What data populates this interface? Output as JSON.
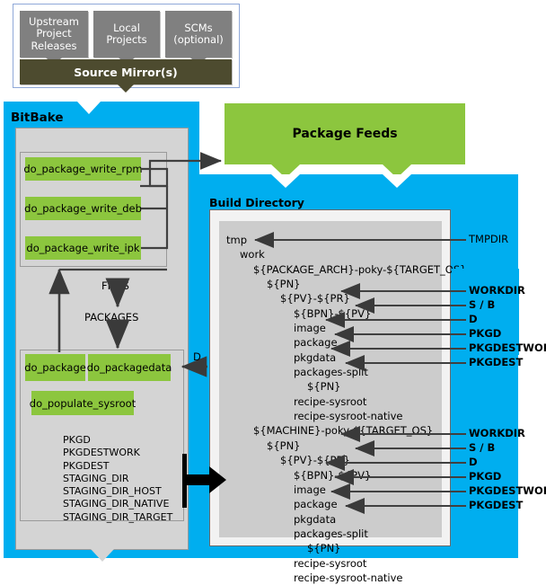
{
  "source_group": {
    "boxes": [
      {
        "label": "Upstream\nProject\nReleases",
        "name": "upstream-project-releases"
      },
      {
        "label": "Local\nProjects",
        "name": "local-projects"
      },
      {
        "label": "SCMs\n(optional)",
        "name": "scms-optional"
      }
    ],
    "mirror_label": "Source Mirror(s)"
  },
  "bitbake": {
    "title": "BitBake",
    "write_tasks": [
      "do_package_write_rpm",
      "do_package_write_deb",
      "do_package_write_ipk"
    ],
    "flow_labels": {
      "files": "FILES",
      "packages": "PACKAGES"
    },
    "package_tasks": [
      "do_package",
      "do_packagedata",
      "do_populate_sysroot"
    ],
    "variables": [
      "PKGD",
      "PKGDESTWORK",
      "PKGDEST",
      "STAGING_DIR",
      "STAGING_DIR_HOST",
      "STAGING_DIR_NATIVE",
      "STAGING_DIR_TARGET"
    ],
    "d_arrow_label": "D"
  },
  "package_feeds": {
    "title": "Package Feeds"
  },
  "build_directory": {
    "title": "Build Directory",
    "tree": [
      {
        "indent": 0,
        "text": "tmp"
      },
      {
        "indent": 1,
        "text": "work"
      },
      {
        "indent": 2,
        "text": "${PACKAGE_ARCH}-poky-${TARGET_OS}"
      },
      {
        "indent": 3,
        "text": "${PN}"
      },
      {
        "indent": 4,
        "text": "${PV}-${PR}"
      },
      {
        "indent": 5,
        "text": "${BPN}-${PV}"
      },
      {
        "indent": 5,
        "text": "image"
      },
      {
        "indent": 5,
        "text": "package"
      },
      {
        "indent": 5,
        "text": "pkgdata"
      },
      {
        "indent": 5,
        "text": "packages-split"
      },
      {
        "indent": 6,
        "text": "${PN}"
      },
      {
        "indent": 5,
        "text": "recipe-sysroot"
      },
      {
        "indent": 5,
        "text": "recipe-sysroot-native"
      },
      {
        "indent": 2,
        "text": "${MACHINE}-poky-${TARGET_OS}"
      },
      {
        "indent": 3,
        "text": "${PN}"
      },
      {
        "indent": 4,
        "text": "${PV}-${PR}"
      },
      {
        "indent": 5,
        "text": "${BPN}-${PV}"
      },
      {
        "indent": 5,
        "text": "image"
      },
      {
        "indent": 5,
        "text": "package"
      },
      {
        "indent": 5,
        "text": "pkgdata"
      },
      {
        "indent": 5,
        "text": "packages-split"
      },
      {
        "indent": 6,
        "text": "${PN}"
      },
      {
        "indent": 5,
        "text": "recipe-sysroot"
      },
      {
        "indent": 5,
        "text": "recipe-sysroot-native"
      }
    ]
  },
  "side_labels": {
    "tmpdir": "TMPDIR",
    "group_one": [
      "WORKDIR",
      "S / B",
      "D",
      "PKGD",
      "PKGDESTWORK",
      "PKGDEST"
    ],
    "group_two": [
      "WORKDIR",
      "S / B",
      "D",
      "PKGD",
      "PKGDESTWORK",
      "PKGDEST"
    ]
  },
  "colors": {
    "blue": "#00aeef",
    "green": "#8cc63e",
    "gray_box": "#808080",
    "mirror_olive": "#4d4b2f",
    "panel_gray": "#d4d4d4",
    "tree_gray": "#cccccc",
    "arrow": "#404040"
  }
}
